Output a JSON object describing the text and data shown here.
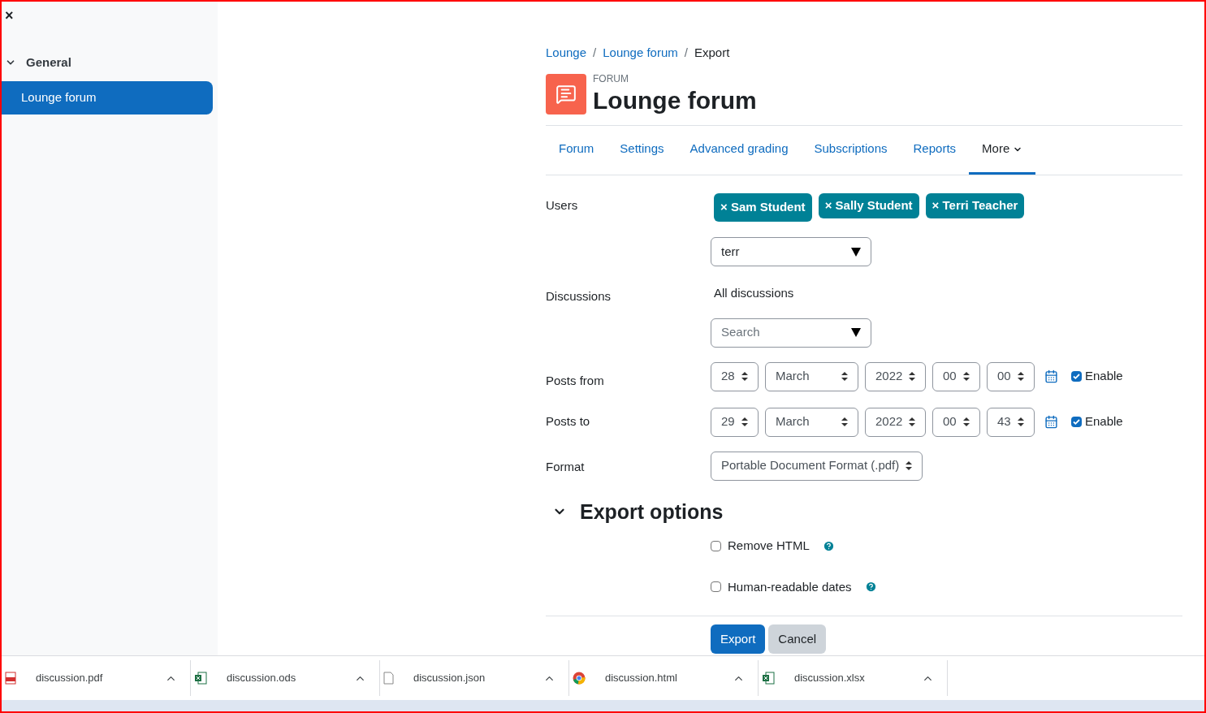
{
  "drawer": {
    "close": "×",
    "section": {
      "label": "General",
      "expanded": true
    },
    "items": [
      {
        "label": "Lounge forum",
        "selected": true
      }
    ]
  },
  "breadcrumb": [
    "Lounge",
    "Lounge forum",
    "Export"
  ],
  "breadcrumb_separators": [
    "/",
    "/"
  ],
  "header": {
    "kicker": "FORUM",
    "title": "Lounge forum"
  },
  "tabs": [
    {
      "label": "Forum",
      "selected": false
    },
    {
      "label": "Settings",
      "selected": false
    },
    {
      "label": "Advanced grading",
      "selected": false
    },
    {
      "label": "Subscriptions",
      "selected": false
    },
    {
      "label": "Reports",
      "selected": false
    },
    {
      "label": "More",
      "selected": true
    }
  ],
  "form": {
    "users_label": "Users",
    "users": [
      "Sam Student",
      "Sally Student",
      "Terri Teacher"
    ],
    "tag_remove": "×",
    "users_search": "terr",
    "discussions_label": "Discussions",
    "discussions_value": "All discussions",
    "discussions_placeholder": "Search",
    "dates": [
      {
        "label": "Posts from",
        "day": "28",
        "month": "March",
        "year": "2022",
        "hour": "00",
        "minute": "00",
        "enable": "Enable",
        "enabled": true
      },
      {
        "label": "Posts to",
        "day": "29",
        "month": "March",
        "year": "2022",
        "hour": "00",
        "minute": "43",
        "enable": "Enable",
        "enabled": true
      }
    ],
    "format_label": "Format",
    "format": "Portable Document Format (.pdf)"
  },
  "export_options": {
    "title": "Export options",
    "expanded": true,
    "options": [
      {
        "label": "Remove HTML",
        "checked": false
      },
      {
        "label": "Human-readable dates",
        "checked": false
      }
    ]
  },
  "buttons": {
    "primary": "Export",
    "secondary": "Cancel"
  },
  "downloads": [
    {
      "name": "discussion.pdf",
      "kind": "pdf"
    },
    {
      "name": "discussion.ods",
      "kind": "sheet"
    },
    {
      "name": "discussion.json",
      "kind": "file"
    },
    {
      "name": "discussion.html",
      "kind": "browser"
    },
    {
      "name": "discussion.xlsx",
      "kind": "sheet"
    }
  ]
}
